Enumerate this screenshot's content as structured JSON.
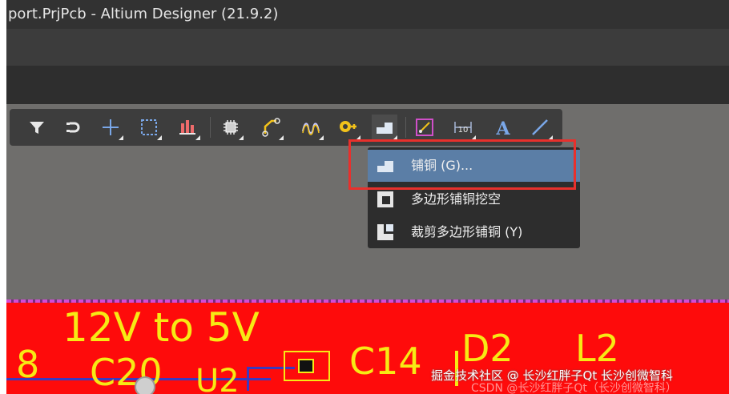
{
  "window": {
    "title": "port.PrjPcb - Altium Designer (21.9.2)"
  },
  "toolbar": {
    "buttons": [
      {
        "icon": "filter-icon",
        "label": ""
      },
      {
        "icon": "net-highlight-icon",
        "label": ""
      },
      {
        "icon": "crosshair-icon",
        "label": ""
      },
      {
        "icon": "select-rectangle-icon",
        "label": ""
      },
      {
        "icon": "align-icon",
        "label": ""
      },
      {
        "icon": "component-icon",
        "label": ""
      },
      {
        "icon": "route-icon",
        "label": ""
      },
      {
        "icon": "differential-pair-icon",
        "label": ""
      },
      {
        "icon": "via-icon",
        "label": ""
      },
      {
        "icon": "polygon-pour-icon",
        "label": ""
      },
      {
        "icon": "dimension-icon",
        "label": ""
      },
      {
        "icon": "string-icon",
        "label": "10"
      },
      {
        "icon": "text-icon",
        "label": "A"
      },
      {
        "icon": "line-icon",
        "label": ""
      }
    ]
  },
  "dropdown": {
    "items": [
      {
        "label": "铺铜 (G)...",
        "icon": "polygon-pour-icon",
        "selected": true
      },
      {
        "label": "多边形铺铜挖空",
        "icon": "polygon-cutout-icon",
        "selected": false
      },
      {
        "label": "裁剪多边形铺铜 (Y)",
        "icon": "slice-polygon-icon",
        "selected": false
      }
    ]
  },
  "pcb": {
    "silkscreen": {
      "title": "12V to 5V",
      "left_num": "8",
      "c20": "C20",
      "u2": "U2",
      "c14": "C14",
      "d2": "D2",
      "l2": "L2"
    }
  },
  "watermark": {
    "line1": "掘金技术社区 @ 长沙红胖子Qt 长沙创微智科",
    "line2": "CSDN @长沙红胖子Qt（长沙创微智科）"
  },
  "colors": {
    "highlight": "#5b7ea6",
    "annotation_box": "#e8302c",
    "board": "#fe0b0b",
    "silkscreen": "#f7ea14"
  }
}
